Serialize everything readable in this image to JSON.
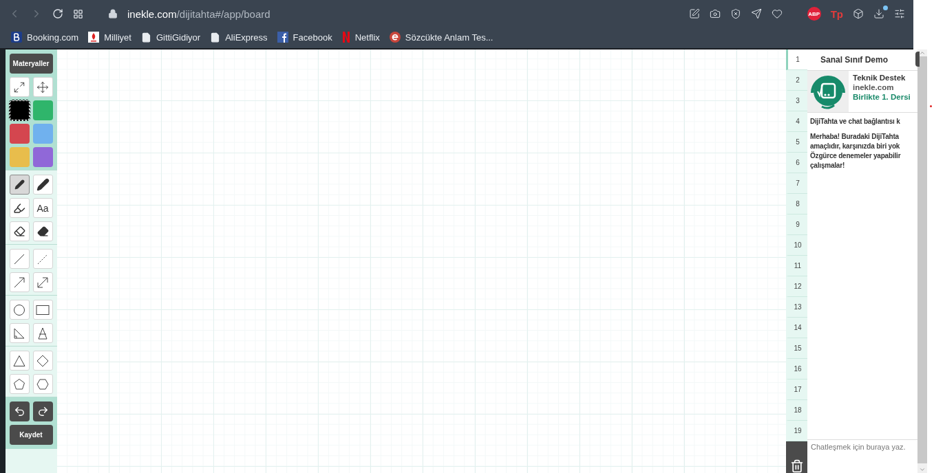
{
  "browser": {
    "url_host": "inekle.com",
    "url_path": "/dijitahta#/app/board",
    "extension_badges": [
      {
        "kind": "abp",
        "label": "ABP"
      },
      {
        "kind": "tp",
        "label": "Tp"
      }
    ],
    "bookmarks": [
      {
        "kind": "booking",
        "label": "Booking.com"
      },
      {
        "kind": "milliyet",
        "label": "Milliyet"
      },
      {
        "kind": "page",
        "label": "GittiGidiyor"
      },
      {
        "kind": "page",
        "label": "AliExpress"
      },
      {
        "kind": "facebook",
        "label": "Facebook"
      },
      {
        "kind": "netflix",
        "label": "Netflix"
      },
      {
        "kind": "circle-e",
        "label": "Sözcükte Anlam Tes..."
      }
    ]
  },
  "toolbar": {
    "materials_button": "Materyaller",
    "colors": [
      {
        "color": "#000000",
        "selected": true
      },
      {
        "color": "#2fb56b",
        "selected": false
      },
      {
        "color": "#d4464f",
        "selected": false
      },
      {
        "color": "#70b1ee",
        "selected": false
      },
      {
        "color": "#e8bd4c",
        "selected": false
      },
      {
        "color": "#9068d8",
        "selected": false
      }
    ],
    "tool_groups": [
      [
        {
          "kind": "pencil",
          "selected": true
        },
        {
          "kind": "marker",
          "selected": false
        },
        {
          "kind": "highlighter",
          "selected": false
        },
        {
          "kind": "text",
          "label": "Aa",
          "selected": false
        },
        {
          "kind": "eraser-lines",
          "selected": false
        },
        {
          "kind": "eraser",
          "selected": false
        }
      ],
      [
        {
          "kind": "line",
          "selected": false
        },
        {
          "kind": "dashed-line",
          "selected": false
        },
        {
          "kind": "arrow",
          "selected": false
        },
        {
          "kind": "double-arrow",
          "selected": false
        }
      ],
      [
        {
          "kind": "circle",
          "selected": false
        },
        {
          "kind": "rectangle",
          "selected": false
        },
        {
          "kind": "right-triangle",
          "selected": false
        },
        {
          "kind": "isosceles-triangle",
          "selected": false
        }
      ],
      [
        {
          "kind": "triangle",
          "selected": false
        },
        {
          "kind": "diamond",
          "selected": false
        },
        {
          "kind": "pentagon",
          "selected": false
        },
        {
          "kind": "hexagon",
          "selected": false
        }
      ]
    ],
    "save_button": "Kaydet"
  },
  "chat": {
    "title": "Sanal Sınıf Demo",
    "card": {
      "name": "Teknik Destek",
      "site": "inekle.com",
      "subtitle": "Birlikte 1. Dersi"
    },
    "messages": [
      [
        "DijiTahta ve chat bağlantısı k"
      ],
      [
        "Merhaba! Buradaki DijiTahta",
        "amaçlıdır, karşınızda biri yok",
        "Özgürce denemeler yapabilir",
        "çalışmalar!"
      ]
    ],
    "line_numbers": [
      {
        "label": "1",
        "selected": true
      },
      {
        "label": "2",
        "selected": false
      },
      {
        "label": "3",
        "selected": false
      },
      {
        "label": "4",
        "selected": false
      },
      {
        "label": "5",
        "selected": false
      },
      {
        "label": "6",
        "selected": false
      },
      {
        "label": "7",
        "selected": false
      },
      {
        "label": "8",
        "selected": false
      },
      {
        "label": "9",
        "selected": false
      },
      {
        "label": "10",
        "selected": false
      },
      {
        "label": "11",
        "selected": false
      },
      {
        "label": "12",
        "selected": false
      },
      {
        "label": "13",
        "selected": false
      },
      {
        "label": "14",
        "selected": false
      },
      {
        "label": "15",
        "selected": false
      },
      {
        "label": "16",
        "selected": false
      },
      {
        "label": "17",
        "selected": false
      },
      {
        "label": "18",
        "selected": false
      },
      {
        "label": "19",
        "selected": false
      }
    ],
    "input": {
      "placeholder": "Chatleşmek için buraya yaz."
    }
  }
}
